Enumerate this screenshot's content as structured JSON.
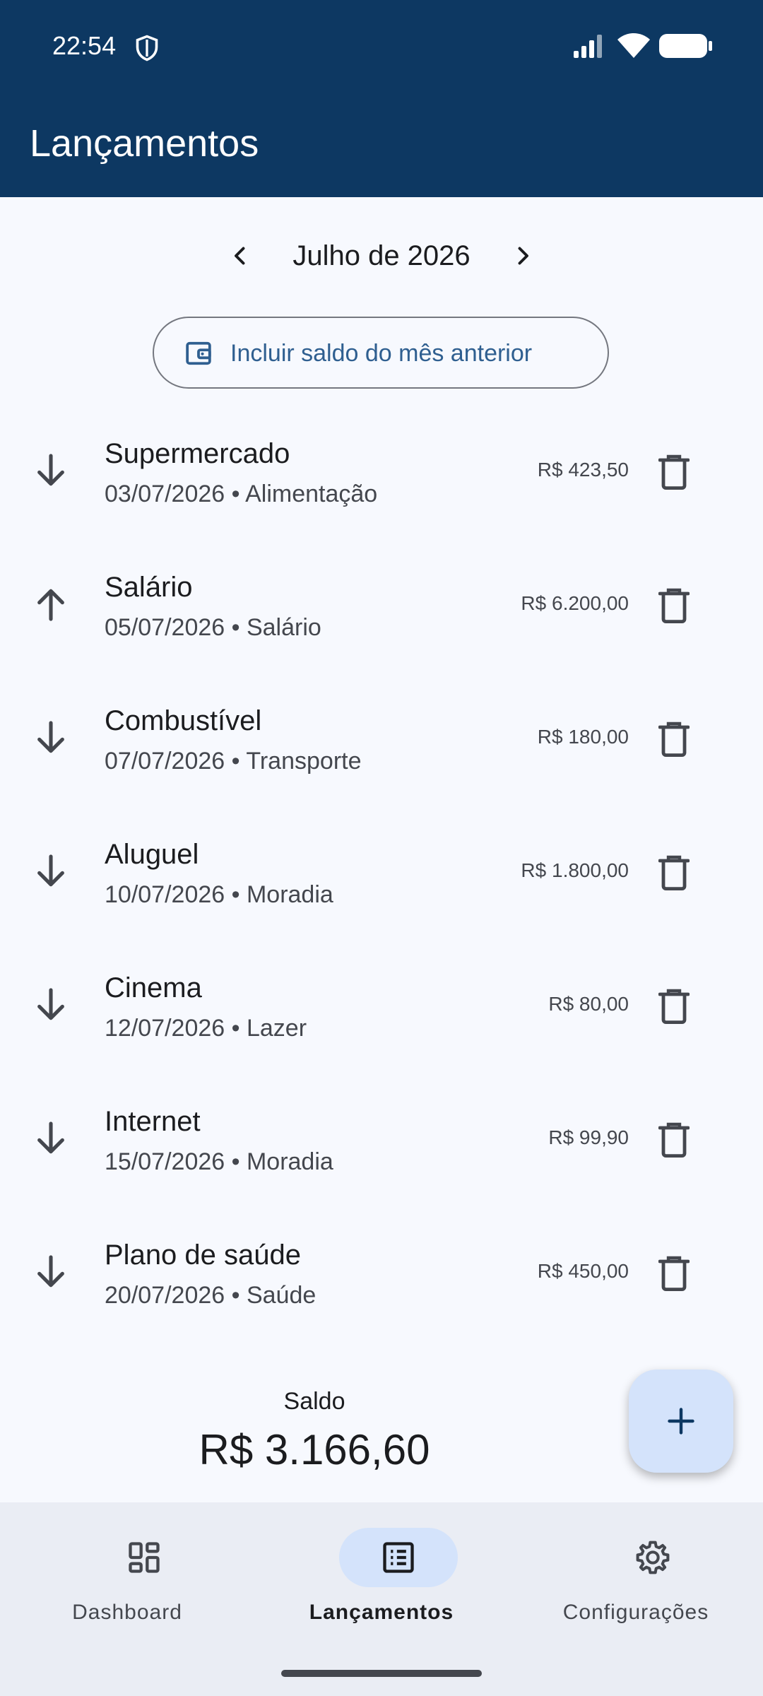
{
  "status_bar": {
    "time": "22:54"
  },
  "app_bar": {
    "title": "Lançamentos"
  },
  "month_nav": {
    "label": "Julho de 2026"
  },
  "prev_balance_button": {
    "label": "Incluir saldo do mês anterior"
  },
  "transactions": [
    {
      "title": "Supermercado",
      "subtitle": "03/07/2026 • Alimentação",
      "amount": "R$ 423,50",
      "direction": "down"
    },
    {
      "title": "Salário",
      "subtitle": "05/07/2026 • Salário",
      "amount": "R$ 6.200,00",
      "direction": "up"
    },
    {
      "title": "Combustível",
      "subtitle": "07/07/2026 • Transporte",
      "amount": "R$ 180,00",
      "direction": "down"
    },
    {
      "title": "Aluguel",
      "subtitle": "10/07/2026 • Moradia",
      "amount": "R$ 1.800,00",
      "direction": "down"
    },
    {
      "title": "Cinema",
      "subtitle": "12/07/2026 • Lazer",
      "amount": "R$ 80,00",
      "direction": "down"
    },
    {
      "title": "Internet",
      "subtitle": "15/07/2026 • Moradia",
      "amount": "R$ 99,90",
      "direction": "down"
    },
    {
      "title": "Plano de saúde",
      "subtitle": "20/07/2026 • Saúde",
      "amount": "R$ 450,00",
      "direction": "down"
    }
  ],
  "balance": {
    "label": "Saldo",
    "value": "R$ 3.166,60"
  },
  "bottom_nav": {
    "items": [
      {
        "label": "Dashboard",
        "icon": "dashboard-icon",
        "active": false
      },
      {
        "label": "Lançamentos",
        "icon": "list-icon",
        "active": true
      },
      {
        "label": "Configurações",
        "icon": "gear-icon",
        "active": false
      }
    ]
  },
  "colors": {
    "app_bar": "#0d3862",
    "background": "#f7f9fe",
    "accent_container": "#d4e3fb",
    "accent_text": "#2f5f90",
    "nav_background": "#eaedf4"
  }
}
